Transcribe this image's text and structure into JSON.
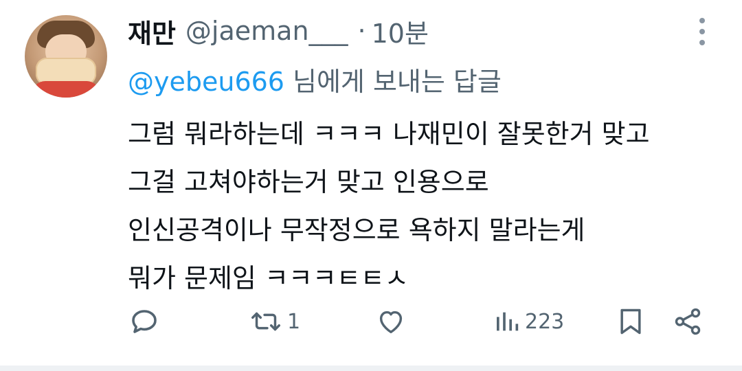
{
  "tweet": {
    "author": {
      "name": "재만",
      "handle": "@jaeman___",
      "time_sep": "·",
      "time": "10분"
    },
    "reply_to": {
      "mention": "@yebeu666",
      "suffix": "님에게 보내는 답글"
    },
    "text_lines": [
      "그럼 뭐라하는데 ㅋㅋㅋ 나재민이 잘못한거 맞고",
      "그걸 고쳐야하는거 맞고 인용으로",
      "인신공격이나 무작정으로 욕하지 말라는게",
      "뭐가 문제임 ㅋㅋㅋㅌㅌㅅ"
    ],
    "actions": {
      "reply_icon": "reply-icon",
      "retweet_icon": "retweet-icon",
      "retweet_count": "1",
      "like_icon": "heart-icon",
      "views_icon": "views-icon",
      "views_count": "223",
      "bookmark_icon": "bookmark-icon",
      "share_icon": "share-icon"
    }
  },
  "colors": {
    "text": "#0f1419",
    "muted": "#536471",
    "link": "#1d9bf0",
    "background": "#ffffff"
  }
}
